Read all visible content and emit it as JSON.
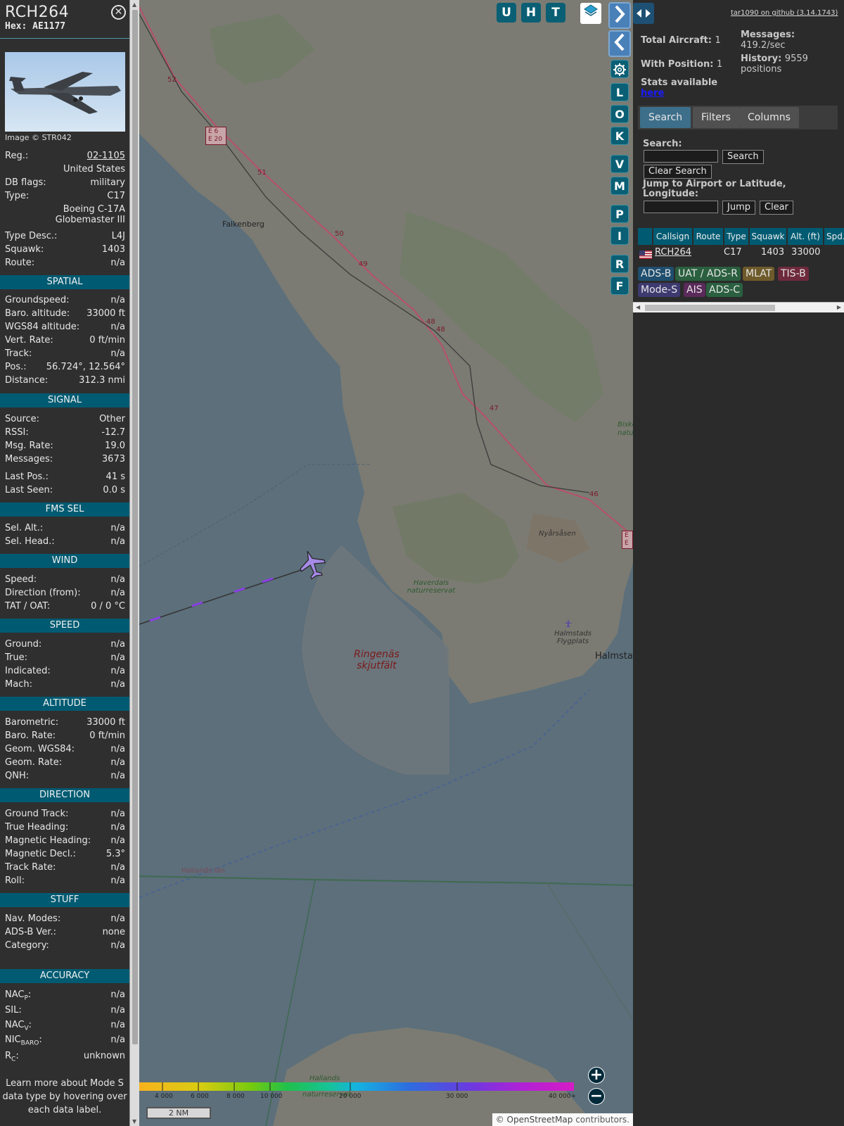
{
  "sidebar": {
    "callsign": "RCH264",
    "hex": "Hex: AE1177",
    "photo_credit": "Image © STR042",
    "reg_label": "Reg.:",
    "reg_value": "02-1105",
    "country": "United States",
    "db_flags_label": "DB flags:",
    "db_flags_value": "military",
    "type_label": "Type:",
    "type_value": "C17",
    "type_full": "Boeing C-17A Globemaster III",
    "type_desc_label": "Type Desc.:",
    "type_desc_value": "L4J",
    "squawk_label": "Squawk:",
    "squawk_value": "1403",
    "route_label": "Route:",
    "route_value": "n/a",
    "spatial": {
      "title": "SPATIAL",
      "rows": [
        {
          "k": "Groundspeed:",
          "v": "n/a"
        },
        {
          "k": "Baro. altitude:",
          "v": "33000 ft"
        },
        {
          "k": "WGS84 altitude:",
          "v": "n/a"
        },
        {
          "k": "Vert. Rate:",
          "v": "0 ft/min"
        },
        {
          "k": "Track:",
          "v": "n/a"
        },
        {
          "k": "Pos.:",
          "v": "56.724°, 12.564°"
        },
        {
          "k": "Distance:",
          "v": "312.3 nmi"
        }
      ]
    },
    "signal": {
      "title": "SIGNAL",
      "rows": [
        {
          "k": "Source:",
          "v": "Other"
        },
        {
          "k": "RSSI:",
          "v": "-12.7"
        },
        {
          "k": "Msg. Rate:",
          "v": "19.0"
        },
        {
          "k": "Messages:",
          "v": "3673"
        },
        {
          "k": "Last Pos.:",
          "v": "41 s"
        },
        {
          "k": "Last Seen:",
          "v": "0.0 s"
        }
      ]
    },
    "fms": {
      "title": "FMS SEL",
      "rows": [
        {
          "k": "Sel. Alt.:",
          "v": "n/a"
        },
        {
          "k": "Sel. Head.:",
          "v": "n/a"
        }
      ]
    },
    "wind": {
      "title": "WIND",
      "rows": [
        {
          "k": "Speed:",
          "v": "n/a"
        },
        {
          "k": "Direction (from):",
          "v": "n/a"
        },
        {
          "k": "TAT / OAT:",
          "v": "0 / 0 °C"
        }
      ]
    },
    "speed": {
      "title": "SPEED",
      "rows": [
        {
          "k": "Ground:",
          "v": "n/a"
        },
        {
          "k": "True:",
          "v": "n/a"
        },
        {
          "k": "Indicated:",
          "v": "n/a"
        },
        {
          "k": "Mach:",
          "v": "n/a"
        }
      ]
    },
    "altitude": {
      "title": "ALTITUDE",
      "rows": [
        {
          "k": "Barometric:",
          "v": "33000 ft"
        },
        {
          "k": "Baro. Rate:",
          "v": "0 ft/min"
        },
        {
          "k": "Geom. WGS84:",
          "v": "n/a"
        },
        {
          "k": "Geom. Rate:",
          "v": "n/a"
        },
        {
          "k": "QNH:",
          "v": "n/a"
        }
      ]
    },
    "direction": {
      "title": "DIRECTION",
      "rows": [
        {
          "k": "Ground Track:",
          "v": "n/a"
        },
        {
          "k": "True Heading:",
          "v": "n/a"
        },
        {
          "k": "Magnetic Heading:",
          "v": "n/a"
        },
        {
          "k": "Magnetic Decl.:",
          "v": "5.3°"
        },
        {
          "k": "Track Rate:",
          "v": "n/a"
        },
        {
          "k": "Roll:",
          "v": "n/a"
        }
      ]
    },
    "stuff": {
      "title": "STUFF",
      "rows": [
        {
          "k": "Nav. Modes:",
          "v": "n/a"
        },
        {
          "k": "ADS-B Ver.:",
          "v": "none"
        },
        {
          "k": "Category:",
          "v": "n/a"
        }
      ]
    },
    "accuracy": {
      "title": "ACCURACY",
      "rows": [
        {
          "k": "NAC",
          "sub": "P",
          "v": "n/a"
        },
        {
          "k": "SIL:",
          "sub": "",
          "v": "n/a"
        },
        {
          "k": "NAC",
          "sub": "V",
          "v": "n/a"
        },
        {
          "k": "NIC",
          "sub": "BARO",
          "v": "n/a"
        },
        {
          "k": "R",
          "sub": "C",
          "v": "unknown"
        }
      ]
    },
    "learn_more": "Learn more about Mode S data type by hovering over each data label."
  },
  "map": {
    "top_buttons": [
      "U",
      "H",
      "T"
    ],
    "side_buttons": [
      "L",
      "O",
      "K",
      "V",
      "M",
      "P",
      "I",
      "R",
      "F"
    ],
    "places": {
      "falkenberg": "Falkenberg",
      "nyarsasen": "Nyårsåsen",
      "haverdals": "Haverdals naturreservat",
      "ringenas": "Ringenäs skjutfält",
      "halmstads_fp": "Halmstads Flygplats",
      "halmstad": "Halmsta",
      "hallands_lan": "Hallands län",
      "hallands": "Hallands",
      "naturreserv": "naturreservat",
      "bisko": "Bisko",
      "natur": "natur"
    },
    "road_labels": [
      "52",
      "E 6",
      "E 20",
      "51",
      "50",
      "49",
      "48",
      "48",
      "47",
      "46",
      "E",
      "E"
    ],
    "altitude_ticks": [
      "4 000",
      "6 000",
      "8 000",
      "10 000",
      "20 000",
      "30 000",
      "40 000+"
    ],
    "scale_label": "2 NM",
    "attribution_prefix": "© OpenStreetMap",
    "attribution_suffix": " contributors."
  },
  "panel": {
    "github": "tar1090 on github (3.14.1743)",
    "total_aircraft_label": "Total Aircraft:",
    "total_aircraft_value": "1",
    "with_position_label": "With Position:",
    "with_position_value": "1",
    "messages_label": "Messages:",
    "messages_value": "419.2/sec",
    "history_label": "History:",
    "history_value": "9559 positions",
    "stats_label": "Stats available",
    "stats_link": "here",
    "tabs": [
      "Search",
      "Filters",
      "Columns"
    ],
    "search_label": "Search:",
    "search_button": "Search",
    "clear_search_button": "Clear Search",
    "jump_label": "Jump to Airport or Latitude, Longitude:",
    "jump_button": "Jump",
    "clear_button": "Clear",
    "table_headers": [
      "Callsign",
      "Route",
      "Type",
      "Squawk",
      "Alt. (ft)",
      "Spd."
    ],
    "table_row": {
      "callsign": "RCH264",
      "route": "",
      "type": "C17",
      "squawk": "1403",
      "alt": "33000"
    },
    "sources": [
      {
        "label": "ADS-B",
        "bg": "#1f4e6e"
      },
      {
        "label": "UAT / ADS-R",
        "bg": "#2a5f3f"
      },
      {
        "label": "MLAT",
        "bg": "#6e5a2a"
      },
      {
        "label": "TIS-B",
        "bg": "#6e2a3c"
      },
      {
        "label": "Mode-S",
        "bg": "#3d3a70"
      },
      {
        "label": "AIS",
        "bg": "#5a2a5a"
      },
      {
        "label": "ADS-C",
        "bg": "#2a5f3f"
      }
    ]
  }
}
